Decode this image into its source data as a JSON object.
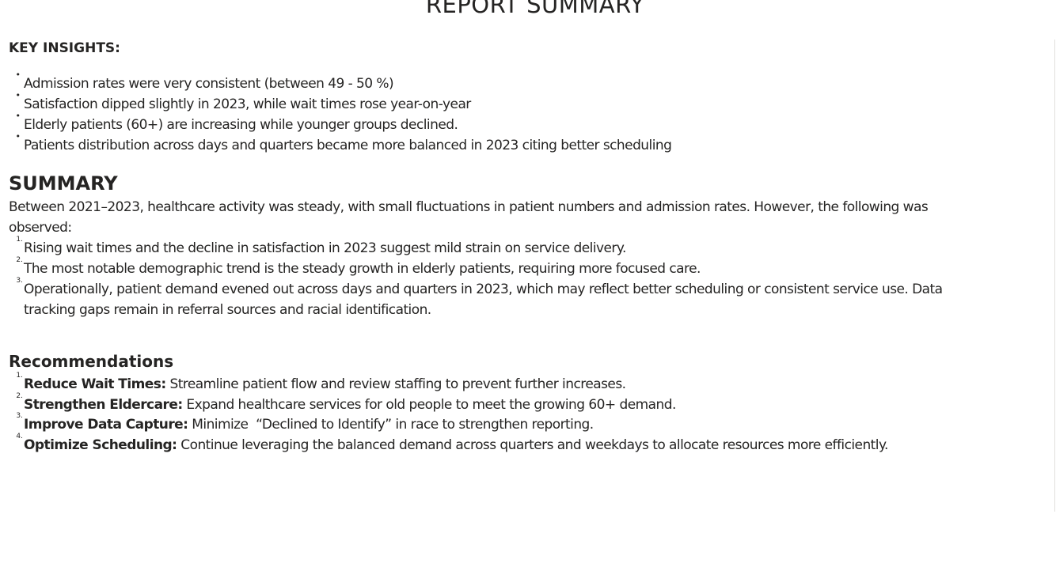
{
  "report": {
    "title": "REPORT SUMMARY"
  },
  "key_insights": {
    "heading": "KEY INSIGHTS:",
    "bullet": "•",
    "items": [
      "Admission rates were very consistent (between 49 - 50 %)",
      "Satisfaction dipped slightly in 2023, while wait times rose year-on-year",
      "Elderly patients (60+) are increasing while younger groups declined.",
      "Patients distribution across days and quarters became more balanced in 2023 citing better scheduling"
    ]
  },
  "summary": {
    "heading": "SUMMARY",
    "intro_line1": "Between 2021–2023, healthcare activity was steady, with small fluctuations in patient numbers and admission rates. However, the following was",
    "intro_line2": "observed:",
    "items": [
      {
        "marker": "1.",
        "text": "Rising wait times and the decline in satisfaction in 2023 suggest mild strain on service delivery."
      },
      {
        "marker": "2.",
        "text": "The most notable demographic trend is the steady growth in elderly patients, requiring more focused care."
      },
      {
        "marker": "3.",
        "text": "Operationally, patient demand evened out across days and quarters in 2023, which may reflect better scheduling or consistent service use. Data",
        "text_cont": "tracking gaps remain in referral sources and racial identification."
      }
    ]
  },
  "recommendations": {
    "heading": "Recommendations",
    "items": [
      {
        "marker": "1.",
        "label": "Reduce Wait Times:",
        "text": " Streamline patient flow and review staffing to prevent further increases."
      },
      {
        "marker": "2.",
        "label": "Strengthen Eldercare:",
        "text": " Expand healthcare services for old people to meet the growing 60+ demand."
      },
      {
        "marker": "3.",
        "label": "Improve Data Capture:",
        "text": " Minimize  “Declined to Identify” in race to strengthen reporting."
      },
      {
        "marker": "4.",
        "label": "Optimize Scheduling:",
        "text": " Continue leveraging the balanced demand across quarters and weekdays to allocate resources more efficiently."
      }
    ]
  }
}
